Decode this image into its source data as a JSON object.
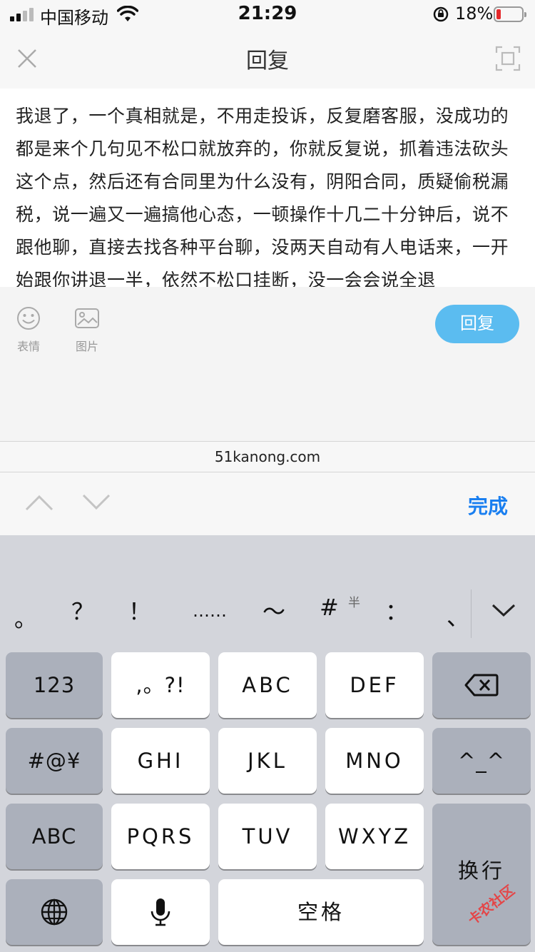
{
  "status_bar": {
    "carrier": "中国移动",
    "time": "21:29",
    "battery_percent": "18%",
    "battery_level": 0.18
  },
  "header": {
    "title": "回复",
    "close_icon": "close-icon",
    "expand_icon": "fullscreen-icon"
  },
  "editor": {
    "text": "我退了，一个真相就是，不用走投诉，反复磨客服，没成功的都是来个几句见不松口就放弃的，你就反复说，抓着违法砍头这个点，然后还有合同里为什么没有，阴阳合同，质疑偷税漏税，说一遍又一遍搞他心态，一顿操作十几二十分钟后，说不跟他聊，直接去找各种平台聊，没两天自动有人电话来，一开始跟你讲退一半，依然不松口挂断，没一会会说全退"
  },
  "toolbar": {
    "emoji_label": "表情",
    "image_label": "图片",
    "reply_label": "回复",
    "accent_color": "#5bbcf0"
  },
  "domain_bar": {
    "domain": "51kanong.com"
  },
  "accessory": {
    "done_label": "完成",
    "done_color": "#1a7ff0"
  },
  "keyboard": {
    "candidates": [
      "。",
      "？",
      "！",
      "……",
      "～",
      "#",
      "：",
      "、"
    ],
    "half_width_mark": "半",
    "keys": {
      "num": "123",
      "punct": ",。?!",
      "abc": "ABC",
      "def": "DEF",
      "symbols": "#@¥",
      "ghi": "GHI",
      "jkl": "JKL",
      "mno": "MNO",
      "emoticon": "^_^",
      "abc_mode": "ABC",
      "pqrs": "PQRS",
      "tuv": "TUV",
      "wxyz": "WXYZ",
      "return": "换行",
      "space": "空格"
    }
  },
  "watermark": {
    "text": "卡农社区"
  }
}
